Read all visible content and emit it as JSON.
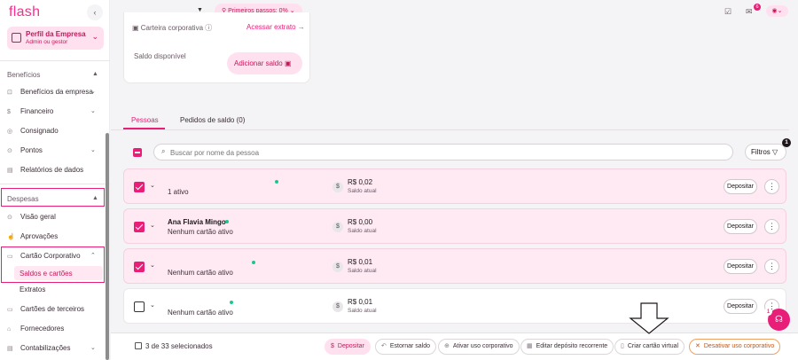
{
  "app": {
    "logo": "flash",
    "collapse_icon": "‹"
  },
  "profile": {
    "name": "Perfil da Empresa",
    "role": "Admin ou gestor"
  },
  "sidebar": {
    "section_benefits": "Benefícios",
    "benefits_items": [
      {
        "label": "Benefícios da empresa",
        "icon": "gift-icon"
      },
      {
        "label": "Financeiro",
        "icon": "money-icon"
      },
      {
        "label": "Consignado",
        "icon": "handshake-icon"
      },
      {
        "label": "Pontos",
        "icon": "clock-icon"
      },
      {
        "label": "Relatórios de dados",
        "icon": "report-icon"
      }
    ],
    "section_expenses": "Despesas",
    "expenses_items": [
      {
        "label": "Visão geral",
        "icon": "overview-icon"
      },
      {
        "label": "Aprovações",
        "icon": "approval-icon"
      },
      {
        "label": "Cartão Corporativo",
        "icon": "card-icon"
      }
    ],
    "card_sub": [
      "Saldos e cartões",
      "Extratos"
    ],
    "more_items": [
      {
        "label": "Cartões de terceiros",
        "icon": "card-icon"
      },
      {
        "label": "Fornecedores",
        "icon": "store-icon"
      },
      {
        "label": "Contabilizações",
        "icon": "ledger-icon"
      }
    ]
  },
  "topbar": {
    "steps": "Primeiros passos: 0%",
    "mail_badge": "6"
  },
  "wallet": {
    "label": "Carteira corporativa",
    "link": "Acessar extrato →",
    "available": "Saldo disponível",
    "add_button": "Adicionar saldo"
  },
  "tabs": [
    "Pessoas",
    "Pedidos de saldo (0)"
  ],
  "search": {
    "placeholder": "Buscar por nome da pessoa"
  },
  "filters": {
    "label": "Filtros",
    "badge": "1"
  },
  "rows": [
    {
      "name": "",
      "sub": "1 ativo",
      "amount": "R$ 0,02",
      "amount_sub": "Saldo atual",
      "deposit": "Depositar",
      "checked": true
    },
    {
      "name": "Ana Flavia Mingo",
      "sub": "Nenhum cartão ativo",
      "amount": "R$ 0,00",
      "amount_sub": "Saldo atual",
      "deposit": "Depositar",
      "checked": true
    },
    {
      "name": "",
      "sub": "Nenhum cartão ativo",
      "amount": "R$ 0,01",
      "amount_sub": "Saldo atual",
      "deposit": "Depositar",
      "checked": true
    },
    {
      "name": "",
      "sub": "Nenhum cartão ativo",
      "amount": "R$ 0,01",
      "amount_sub": "Saldo atual",
      "deposit": "Depositar",
      "checked": false
    }
  ],
  "bottom": {
    "selected": "3 de 33 selecionados",
    "buttons": [
      "Depositar",
      "Estornar saldo",
      "Ativar uso corporativo",
      "Editar depósito recorrente",
      "Criar cartão virtual",
      "Desativar uso corporativo"
    ]
  },
  "help": {
    "badge": "1"
  },
  "colors": {
    "brand": "#e91e78",
    "brand_light": "#ffe0ef",
    "status_active": "#18c98b"
  }
}
